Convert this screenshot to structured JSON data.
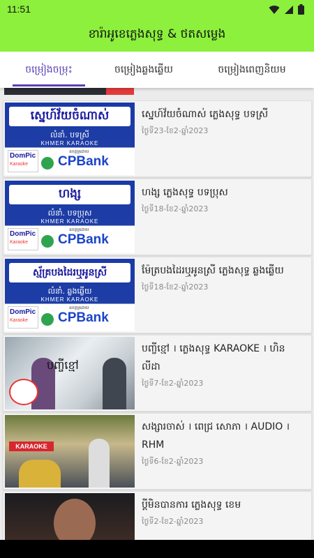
{
  "status_bar": {
    "time": "11:51",
    "icons": [
      "wifi-icon",
      "signal-icon",
      "battery-icon"
    ]
  },
  "app_bar": {
    "title": "ខារ៉ាអូខេភ្លេងសុទ្ធ & ថតសម្លេង"
  },
  "tabs": [
    {
      "label": "ចម្រៀងចម្រុះ",
      "active": true
    },
    {
      "label": "ចម្រៀងឆ្លងឆ្លើយ",
      "active": false
    },
    {
      "label": "ចម្រៀងពេញនិយម",
      "active": false
    }
  ],
  "thumb_common": {
    "karaoke": "KHMER KARAOKE",
    "dompic": "DomPic",
    "dompic_sub": "Karaoke",
    "bank": "CPBank",
    "sponsor": "ឧបត្ថម្ភដោយ"
  },
  "items": [
    {
      "title": "ស្នេហ៍វ័យចំណាស់ ភ្លេងសុទ្ធ បទស្រី",
      "date": "ថ្ងៃទី23-ខែ2-ឆ្នាំ2023",
      "thumb_title": "ស្នេហ៍វ័យចំណាស់",
      "thumb_singer": "លំនាំ. បទស្រី"
    },
    {
      "title": "ហង្ស ភ្លេងសុទ្ធ បទប្រុស",
      "date": "ថ្ងៃទី18-ខែ2-ឆ្នាំ2023",
      "thumb_title": "ហង្ស",
      "thumb_singer": "លំនាំ. បទប្រុស"
    },
    {
      "title": "ម៉ែត្របងដៃរឬអូនស្រី ភ្លេងសុទ្ធ ឆ្លងឆ្លើយ",
      "date": "ថ្ងៃទី18-ខែ2-ឆ្នាំ2023",
      "thumb_title": "ស្ម័គ្របងដៃរឬអូនស្រី",
      "thumb_singer": "លំនាំ. ឆ្លងឆ្លើយ"
    },
    {
      "title": "បញ្ចីខ្មៅ । ភ្លេងសុទ្ធ KARAOKE । ហិន លីដា",
      "date": "ថ្ងៃទី7-ខែ2-ឆ្នាំ2023",
      "thumb_title": "បញ្ចីខ្មៅ"
    },
    {
      "title": "សង្សារចាស់ । ពេជ្រ សោភា । AUDIO । RHM",
      "date": "ថ្ងៃទី6-ខែ2-ឆ្នាំ2023",
      "thumb_title": "KARAOKE"
    },
    {
      "title": "ប្តីមិនបានការ ភ្លេងសុទ្ធ ខេម",
      "date": "ថ្ងៃទី2-ខែ2-ឆ្នាំ2023"
    }
  ]
}
